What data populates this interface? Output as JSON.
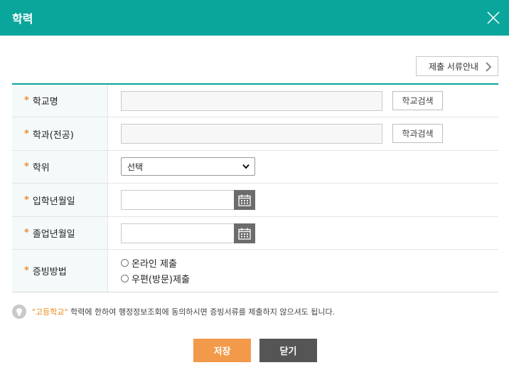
{
  "dialog": {
    "title": "학력"
  },
  "guide_button": {
    "label": "제출 서류안내"
  },
  "form": {
    "school_name": {
      "label": "학교명",
      "search_label": "학교검색"
    },
    "major": {
      "label": "학과(전공)",
      "search_label": "학과검색"
    },
    "degree": {
      "label": "학위",
      "selected": "선택"
    },
    "admission_date": {
      "label": "입학년월일"
    },
    "graduation_date": {
      "label": "졸업년월일"
    },
    "proof_method": {
      "label": "증빙방법",
      "options": [
        "온라인 제출",
        "우편(방문)제출"
      ]
    }
  },
  "notice": {
    "highlight": "\"고등학교\"",
    "text": " 학력에 한하여 행정정보조회에 동의하시면 증빙서류를 제출하지 않으셔도 됩니다."
  },
  "buttons": {
    "save": "저장",
    "close": "닫기"
  },
  "colors": {
    "header": "#0aa59b",
    "required_star": "#f08a2c",
    "save": "#f39a4a",
    "close": "#555555"
  }
}
